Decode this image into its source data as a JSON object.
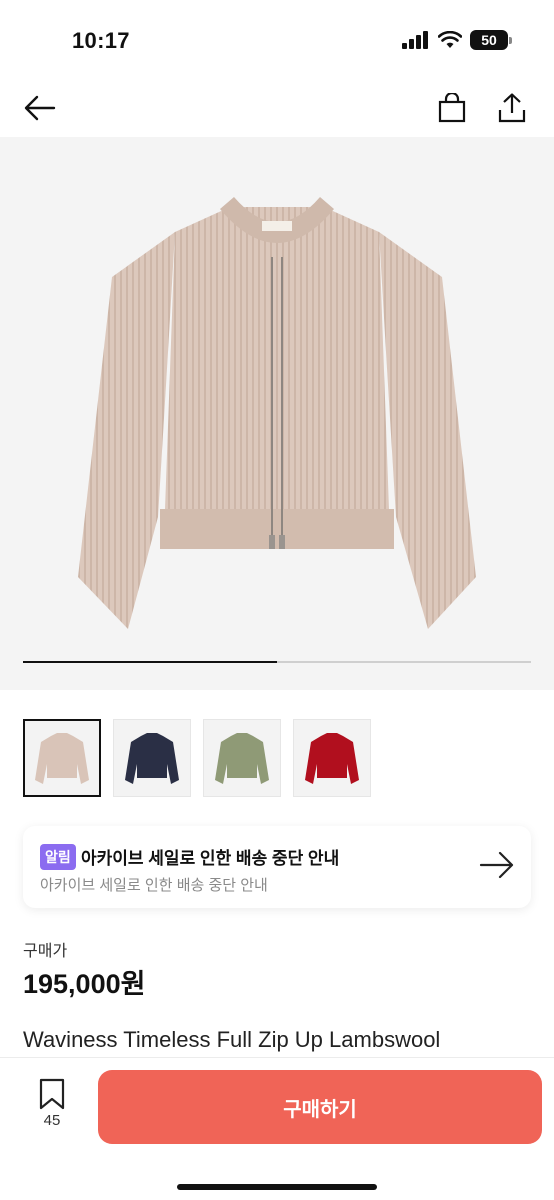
{
  "status_bar": {
    "time": "10:17",
    "battery": "50"
  },
  "nav": {
    "back_icon": "arrow-left-icon",
    "bag_icon": "shopping-bag-icon",
    "share_icon": "share-icon"
  },
  "gallery": {
    "progress": 0.5,
    "main_color": "#d9c4b8",
    "thumbnails": [
      {
        "color": "#d9c4b8",
        "selected": true
      },
      {
        "color": "#2a2f45",
        "selected": false
      },
      {
        "color": "#8f9a76",
        "selected": false
      },
      {
        "color": "#b10f1e",
        "selected": false
      }
    ]
  },
  "notice": {
    "badge": "알림",
    "title": "아카이브 세일로 인한 배송 중단 안내",
    "subtitle": "아카이브 세일로 인한 배송 중단 안내"
  },
  "price": {
    "label": "구매가",
    "value": "195,000원"
  },
  "product": {
    "title": "Waviness Timeless Full Zip Up Lambswool"
  },
  "bottom_bar": {
    "save_count": "45",
    "buy_label": "구매하기"
  },
  "colors": {
    "accent": "#f06457",
    "badge": "#8b6cf0"
  }
}
